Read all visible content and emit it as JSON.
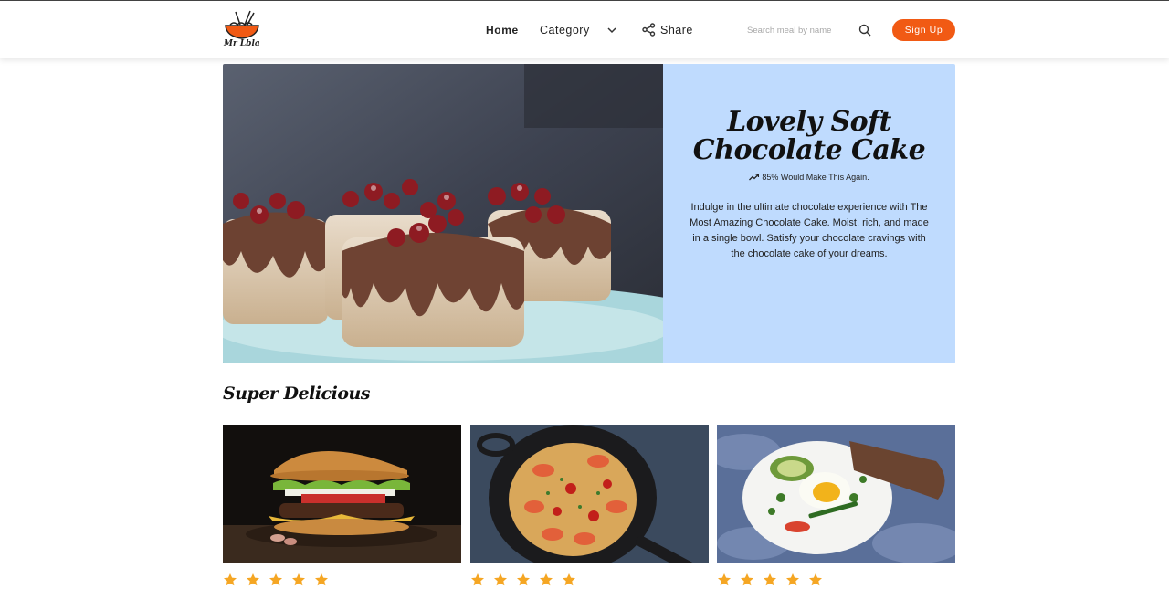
{
  "brand": {
    "name": "Mr Lbla"
  },
  "nav": {
    "home": "Home",
    "category": "Category",
    "share": "Share"
  },
  "search": {
    "placeholder": "Search meal by name",
    "value": ""
  },
  "signup": {
    "label": "Sign Up"
  },
  "hero": {
    "title_line1": "Lovely Soft",
    "title_line2": "Chocolate Cake",
    "stat": "85% Would Make This Again.",
    "description": "Indulge in the ultimate chocolate experience with The Most Amazing Chocolate Cake. Moist, rich, and made in a single bowl. Satisfy your chocolate cravings with the chocolate cake of your dreams."
  },
  "section": {
    "title": "Super Delicious"
  },
  "cards": [
    {
      "image": "burger",
      "rating": 5
    },
    {
      "image": "shrimp-spaghetti",
      "rating": 5
    },
    {
      "image": "egg-avocado-plate",
      "rating": 5
    }
  ],
  "colors": {
    "accent": "#f15a14",
    "hero_panel": "#bfdbfe",
    "star": "#f5a623"
  }
}
